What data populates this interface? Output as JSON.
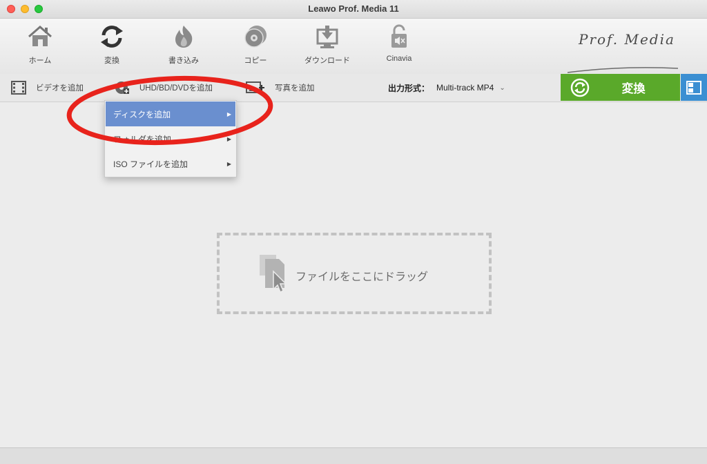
{
  "window": {
    "title": "Leawo Prof. Media 11"
  },
  "nav": {
    "items": [
      {
        "label": "ホーム",
        "icon": "home-icon"
      },
      {
        "label": "変換",
        "icon": "convert-icon"
      },
      {
        "label": "書き込み",
        "icon": "burn-icon"
      },
      {
        "label": "コピー",
        "icon": "copy-icon"
      },
      {
        "label": "ダウンロード",
        "icon": "download-icon"
      },
      {
        "label": "Cinavia",
        "icon": "cinavia-icon"
      }
    ],
    "brand": "Prof. Media"
  },
  "toolbar": {
    "add_video": "ビデオを追加",
    "add_disc": "UHD/BD/DVDを追加",
    "add_photo": "写真を追加",
    "format_label": "出力形式：",
    "format_value": "Multi-track MP4",
    "convert_button": "変換"
  },
  "dropdown": {
    "items": [
      {
        "label": "ディスクを追加",
        "selected": true
      },
      {
        "label": "フォルダを追加",
        "selected": false
      },
      {
        "label": "ISO ファイルを追加",
        "selected": false
      }
    ]
  },
  "dropzone": {
    "text": "ファイルをここにドラッグ"
  },
  "colors": {
    "convert_green": "#5aa92a",
    "selection_blue": "#6a8fcf",
    "annotation_red": "#e8231c"
  }
}
